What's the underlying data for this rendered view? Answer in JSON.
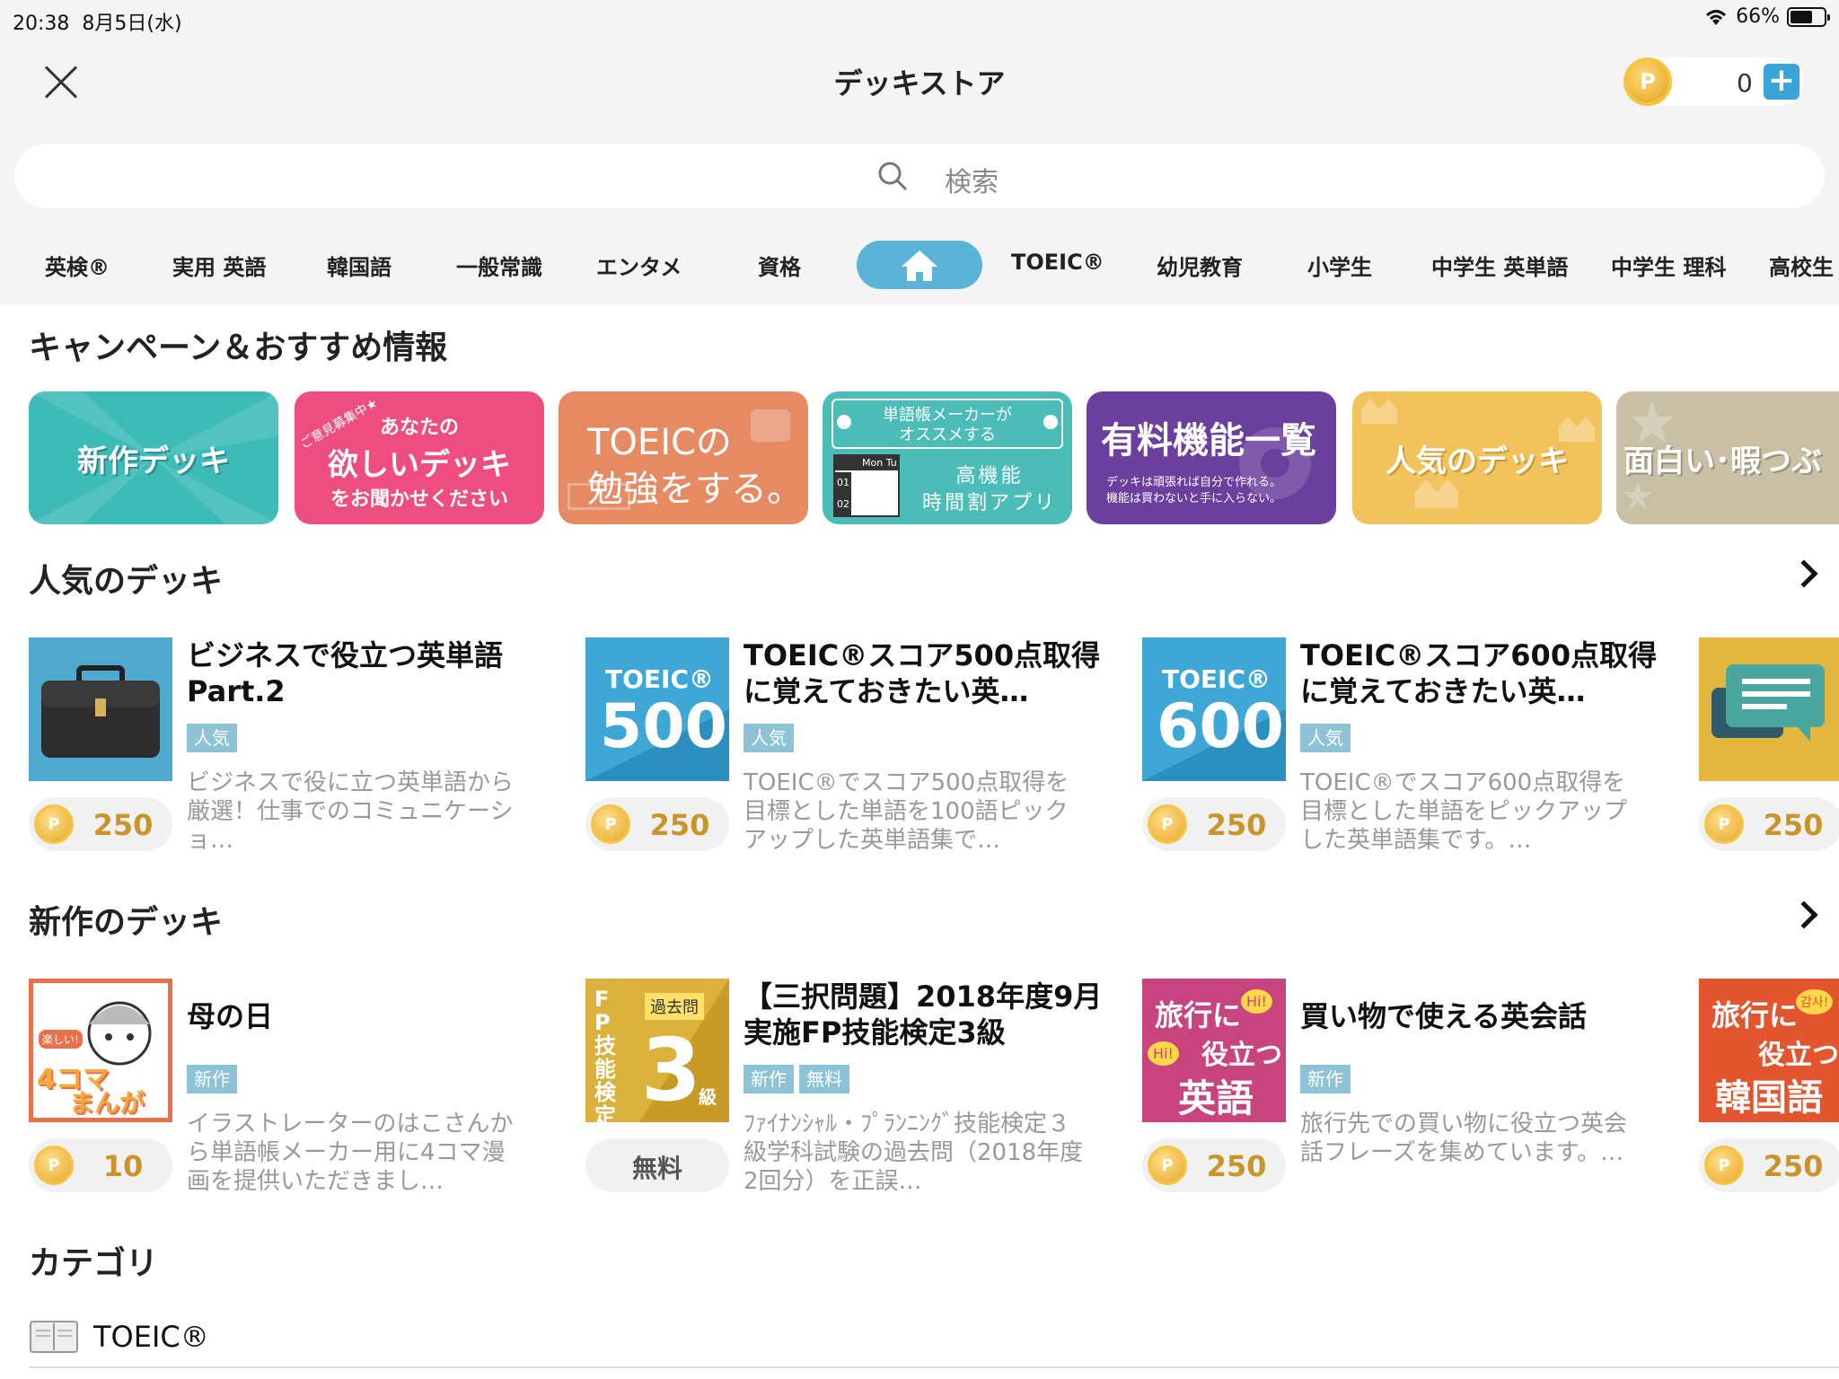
{
  "status": {
    "time": "20:38",
    "date": "8月5日(水)",
    "battery": "66%",
    "battery_level": 0.66
  },
  "header": {
    "title": "デッキストア",
    "points": "0",
    "coin_letter": "P"
  },
  "search": {
    "placeholder": "検索"
  },
  "tabs": [
    "英検®",
    "実用 英語",
    "韓国語",
    "一般常識",
    "エンタメ",
    "資格",
    "TOEIC®",
    "幼児教育",
    "小学生",
    "中学生 英単語",
    "中学生 理科",
    "高校生"
  ],
  "campaign": {
    "title": "キャンペーン＆おすすめ情報",
    "banners": [
      {
        "text": "新作デッキ",
        "color": "#3dbbb8"
      },
      {
        "sub": "ご意見募集中★",
        "line1": "あなたの",
        "line2": "欲しいデッキ",
        "line3": "をお聞かせください",
        "color": "#ee4d7f"
      },
      {
        "line1": "TOEICの",
        "line2": "勉強をする。",
        "color": "#e58a63"
      },
      {
        "line1": "単語帳メーカーが",
        "line2": "オススメする",
        "line3": "高機能",
        "line4": "時間割アプリ",
        "cal_head": "Mon Tu",
        "cal_r1": "01",
        "cal_r2": "02",
        "color": "#4bbcb8"
      },
      {
        "line1": "有料機能一覧",
        "line2": "デッキは頑張れば自分で作れる。",
        "line3": "機能は買わないと手に入らない。",
        "color": "#6a3f9e"
      },
      {
        "text": "人気のデッキ",
        "color": "#f2c25c"
      },
      {
        "text": "面白い･暇つぶ",
        "color": "#c8bfa4"
      }
    ]
  },
  "popular": {
    "title": "人気のデッキ",
    "decks": [
      {
        "title": "ビジネスで役立つ英単語Part.2",
        "tags": [
          "人気"
        ],
        "desc": "ビジネスで役に立つ英単語から厳選！仕事でのコミュニケーショ…",
        "price": "250"
      },
      {
        "title": "TOEIC®スコア500点取得に覚えておきたい英…",
        "tags": [
          "人気"
        ],
        "desc": "TOEIC®でスコア500点取得を目標とした単語を100語ピックアップした英単語集で…",
        "price": "250",
        "thumb_label": "TOEIC®",
        "thumb_num": "500"
      },
      {
        "title": "TOEIC®スコア600点取得に覚えておきたい英…",
        "tags": [
          "人気"
        ],
        "desc": "TOEIC®でスコア600点取得を目標とした単語をピックアップした英単語集です。…",
        "price": "250",
        "thumb_label": "TOEIC®",
        "thumb_num": "600"
      },
      {
        "title": "",
        "tags": [],
        "desc": "",
        "price": "250"
      }
    ]
  },
  "newest": {
    "title": "新作のデッキ",
    "decks": [
      {
        "title": "母の日",
        "tags": [
          "新作"
        ],
        "desc": "イラストレーターのはこさんから単語帳メーカー用に4コマ漫画を提供いただきまし…",
        "price": "10",
        "thumb_l1": "楽しい!",
        "thumb_l2": "4コマ",
        "thumb_l3": "まんが"
      },
      {
        "title": "【三択問題】2018年度9月実施FP技能検定3級",
        "tags": [
          "新作",
          "無料"
        ],
        "desc": "ﾌｧｲﾅﾝｼｬﾙ・ﾌﾟﾗﾝﾆﾝｸﾞ技能検定３級学科試験の過去問（2018年度2回分）を正誤…",
        "price": "無料",
        "thumb_l1": "FP技能検定",
        "thumb_l2": "過去問",
        "thumb_l3": "3",
        "thumb_l4": "級"
      },
      {
        "title": "買い物で使える英会話",
        "tags": [
          "新作"
        ],
        "desc": "旅行先での買い物に役立つ英会話フレーズを集めています。…",
        "price": "250",
        "thumb_l1": "旅行に",
        "thumb_l2": "役立つ",
        "thumb_l3": "英語",
        "thumb_hi": "Hi!"
      },
      {
        "title": "",
        "tags": [],
        "desc": "",
        "price": "250",
        "thumb_l1": "旅行に",
        "thumb_l2": "役立つ",
        "thumb_l3": "韓国語",
        "thumb_hi": "감사!"
      }
    ]
  },
  "categories": {
    "title": "カテゴリ",
    "items": [
      {
        "label": "TOEIC®"
      }
    ]
  }
}
